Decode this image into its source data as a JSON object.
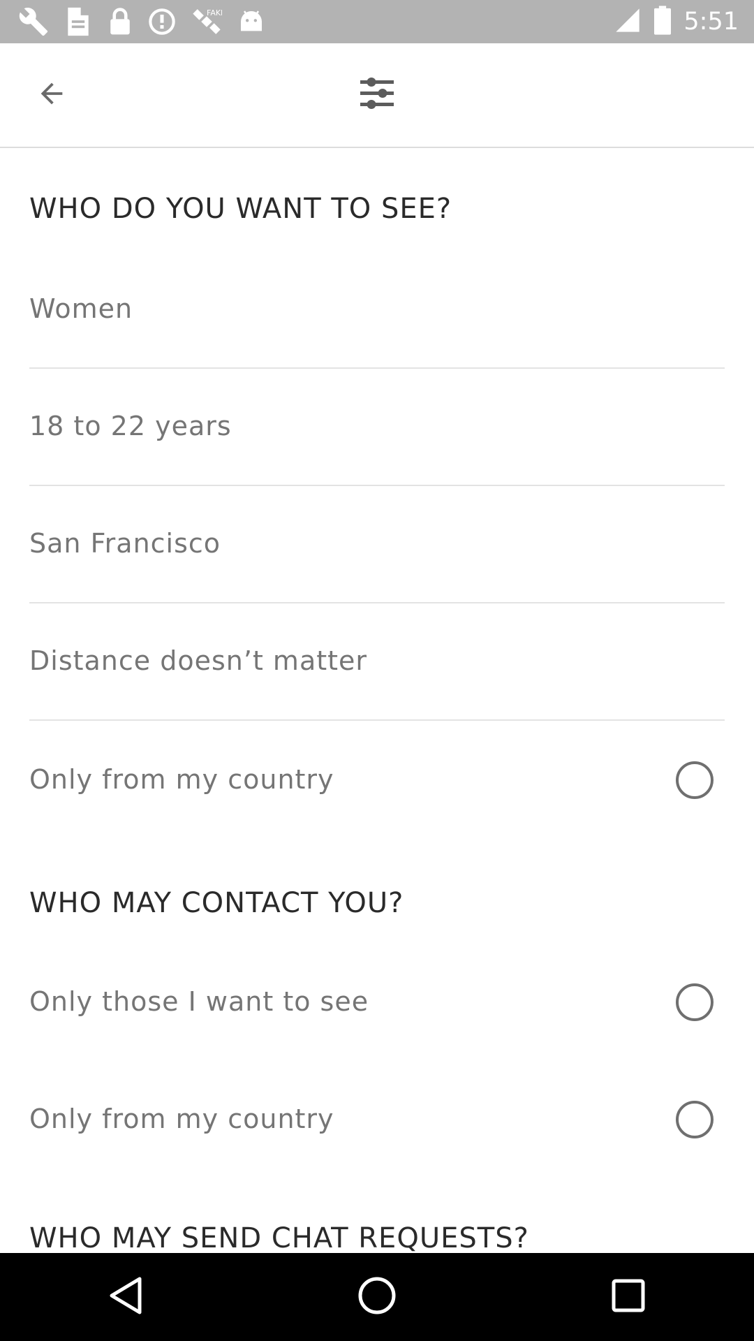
{
  "status_bar": {
    "time": "5:51",
    "icons": [
      "wrench-icon",
      "file-icon",
      "lock-icon",
      "fake-gps-icon",
      "satellite-icon",
      "android-icon",
      "signal-icon",
      "battery-icon"
    ]
  },
  "app_bar": {
    "back_icon": "arrow-back-icon",
    "filter_icon": "sliders-icon"
  },
  "sections": {
    "see": {
      "title": "WHO DO YOU WANT TO SEE?",
      "items": [
        {
          "label": "Women"
        },
        {
          "label": "18 to 22 years"
        },
        {
          "label": "San Francisco"
        },
        {
          "label": "Distance doesn’t matter"
        },
        {
          "label": "Only from my country",
          "checked": false
        }
      ]
    },
    "contact": {
      "title": "WHO MAY CONTACT YOU?",
      "items": [
        {
          "label": "Only those I want to see",
          "checked": false
        },
        {
          "label": "Only from my country",
          "checked": false
        }
      ]
    },
    "chat": {
      "title": "WHO MAY SEND CHAT REQUESTS?"
    }
  },
  "nav_bar": {
    "back_label": "back-triangle-icon",
    "home_label": "home-circle-icon",
    "recents_label": "recents-square-icon"
  },
  "colors": {
    "status_bar": "#b3b3b3",
    "title_text": "#2a2a2a",
    "item_text": "#757575",
    "divider": "#e3e3e3",
    "nav_bar": "#000000"
  }
}
